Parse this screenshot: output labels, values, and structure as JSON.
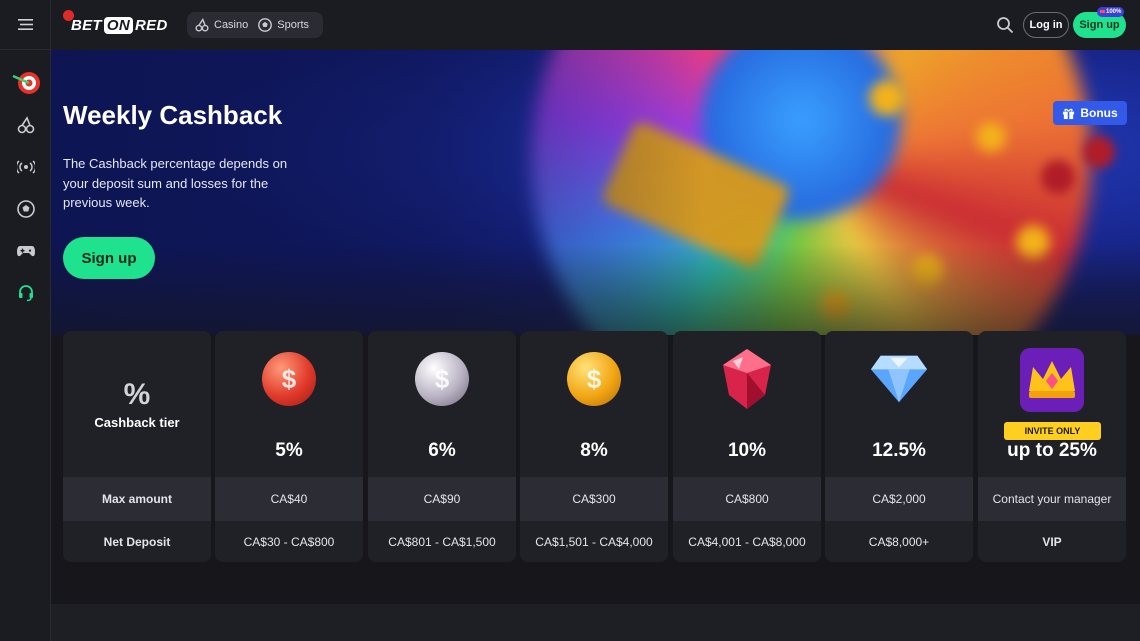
{
  "topbar": {
    "logo": {
      "bet": "BET",
      "on": "ON",
      "red": "RED"
    },
    "nav": [
      {
        "label": "Casino",
        "icon": "cherry-icon"
      },
      {
        "label": "Sports",
        "icon": "soccer-ball-icon"
      }
    ],
    "login_label": "Log in",
    "signup_label": "Sign up",
    "signup_badge": "100%"
  },
  "sidebar": {
    "items": [
      "dart-target-icon",
      "cherry-icon",
      "live-broadcast-icon",
      "soccer-ball-icon",
      "gamepad-icon",
      "headset-support-icon"
    ]
  },
  "hero": {
    "title": "Weekly Cashback",
    "description": "The Cashback percentage depends on your deposit sum and losses for the previous week.",
    "signup_label": "Sign up",
    "bonus_label": "Bonus"
  },
  "tiers": {
    "label_col": {
      "icon": "%",
      "title": "Cashback tier",
      "max_amount_label": "Max amount",
      "net_deposit_label": "Net Deposit"
    },
    "columns": [
      {
        "icon": "red-coin-icon",
        "percent": "5%",
        "max": "CA$40",
        "deposit": "CA$30 - CA$800"
      },
      {
        "icon": "silver-coin-icon",
        "percent": "6%",
        "max": "CA$90",
        "deposit": "CA$801 - CA$1,500"
      },
      {
        "icon": "gold-coin-icon",
        "percent": "8%",
        "max": "CA$300",
        "deposit": "CA$1,501 - CA$4,000"
      },
      {
        "icon": "ruby-icon",
        "percent": "10%",
        "max": "CA$800",
        "deposit": "CA$4,001 - CA$8,000"
      },
      {
        "icon": "diamond-icon",
        "percent": "12.5%",
        "max": "CA$2,000",
        "deposit": "CA$8,000+"
      },
      {
        "icon": "crown-icon",
        "badge": "INVITE ONLY",
        "percent": "up to 25%",
        "max": "Contact your manager",
        "deposit": "VIP"
      }
    ]
  },
  "colors": {
    "accent_green": "#1fe28f",
    "bonus_blue": "#3259e8",
    "vip_yellow": "#ffd21f",
    "panel": "#202127"
  }
}
